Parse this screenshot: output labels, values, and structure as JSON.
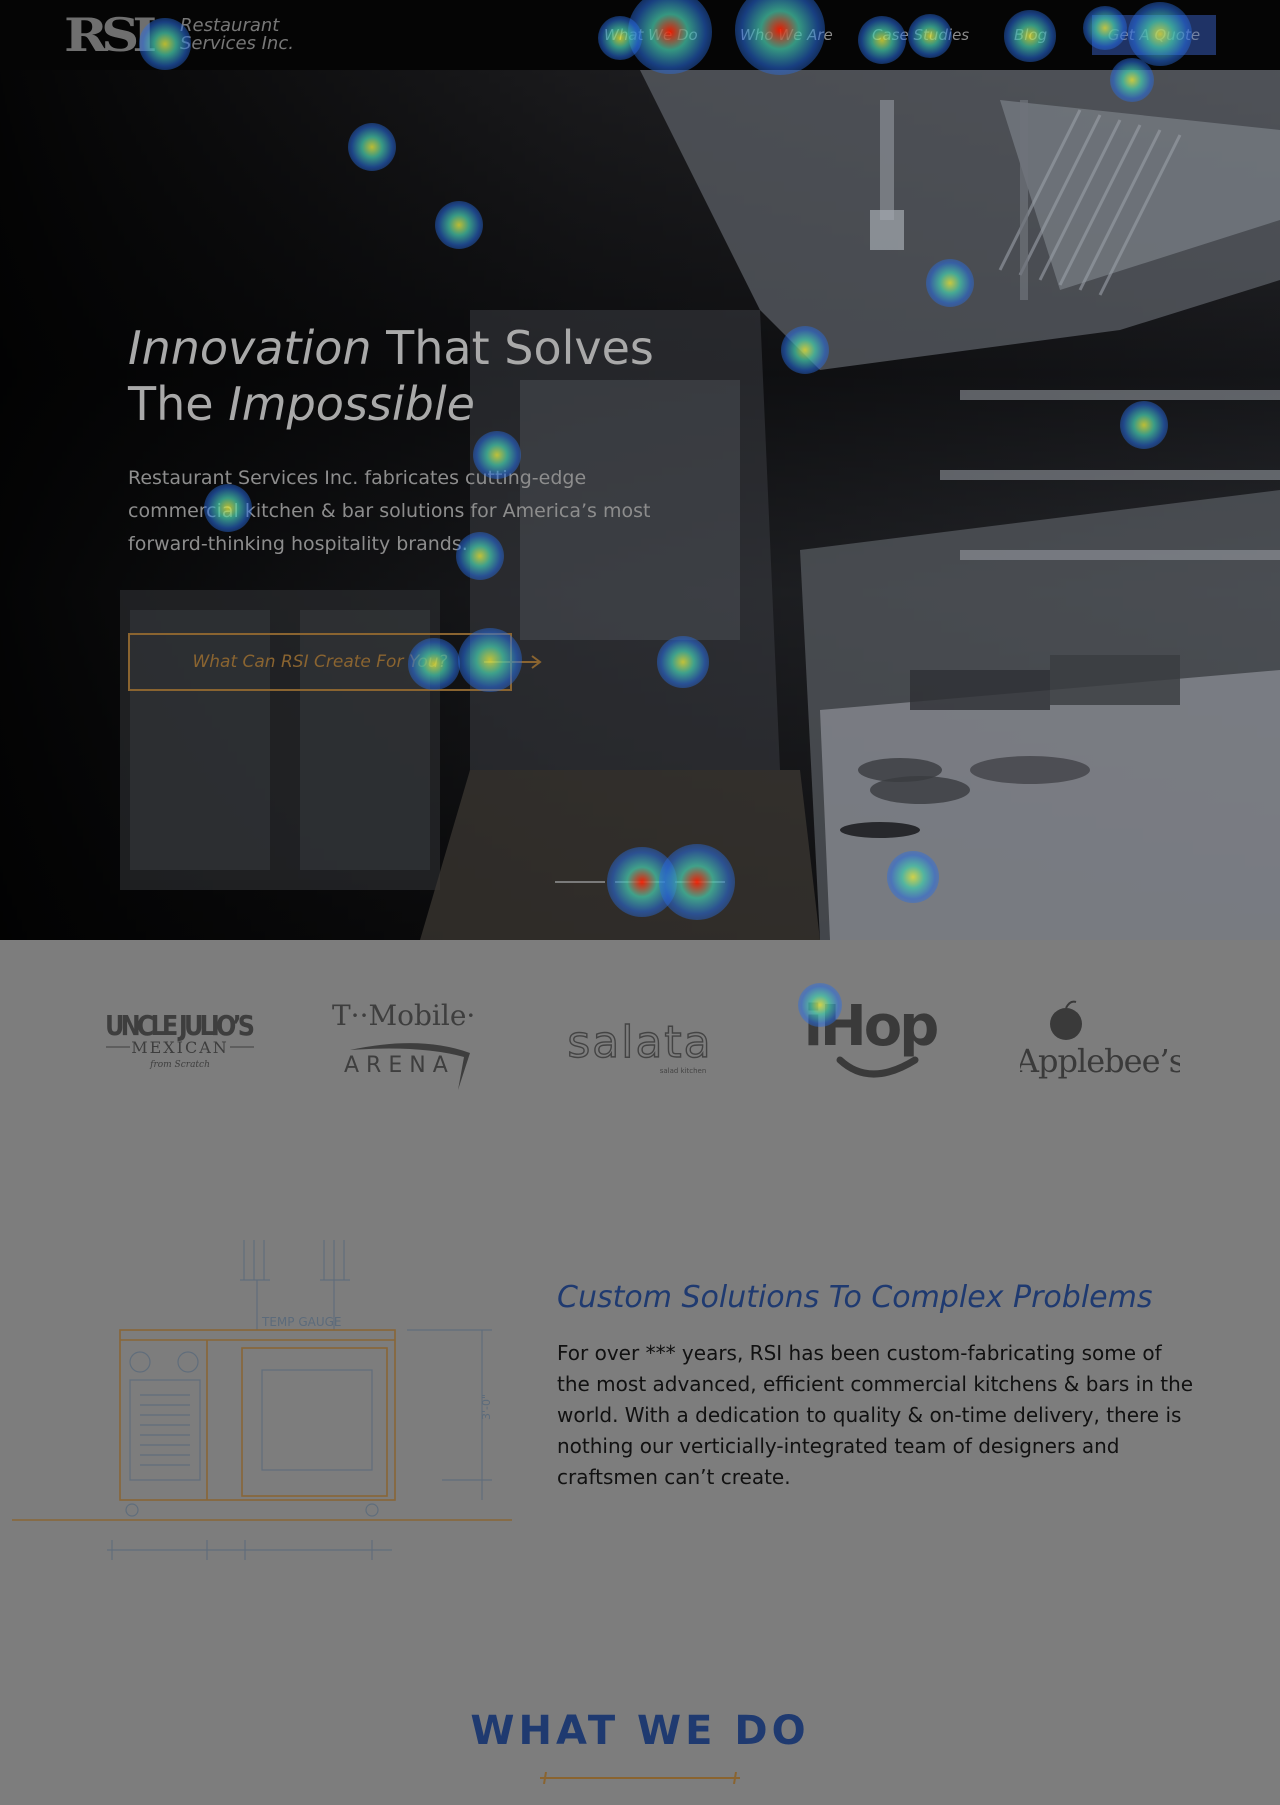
{
  "nav": {
    "logo_mark": "RSI",
    "logo_line1": "Restaurant",
    "logo_line2": "Services Inc.",
    "links": [
      "What We Do",
      "Who We Are",
      "Case Studies",
      "Blog"
    ],
    "quote_label": "Get A Quote"
  },
  "hero": {
    "title_line1_em": "Innovation",
    "title_line1_rest": " That Solves",
    "title_line2_pre": "The ",
    "title_line2_em": "Impossible",
    "subtitle": "Restaurant Services Inc. fabricates cutting-edge commercial kitchen & bar solutions for America’s most forward-thinking hospitality brands.",
    "cta_label": "What Can RSI Create For You?",
    "slide_count": 3
  },
  "clients": {
    "uncle_julios_1": "UNCLE JULIO’S",
    "uncle_julios_2": "MEXICAN",
    "uncle_julios_3": "from Scratch",
    "tmobile_1": "T··Mobile·",
    "tmobile_2": "ARENA",
    "salata_1": "salata",
    "salata_2": "salad kitchen",
    "ihop": "iHop",
    "applebees": "Applebee’s"
  },
  "solutions": {
    "diagram_label": "TEMP GAUGE",
    "diagram_dim": "3'-0\"",
    "title": "Custom Solutions To Complex Problems",
    "body": "For over *** years, RSI has been custom-fabricating some of the most advanced, efficient commercial kitchens & bars in the world. With a dedication to quality & on-time delivery, there is nothing our verticially-integrated team of designers and craftsmen can’t create."
  },
  "what_we_do": {
    "heading": "WHAT WE DO"
  },
  "colors": {
    "brand_navy": "#1f3a70",
    "accent_gold": "#8a6430",
    "page_gray": "#7d7d7d"
  }
}
